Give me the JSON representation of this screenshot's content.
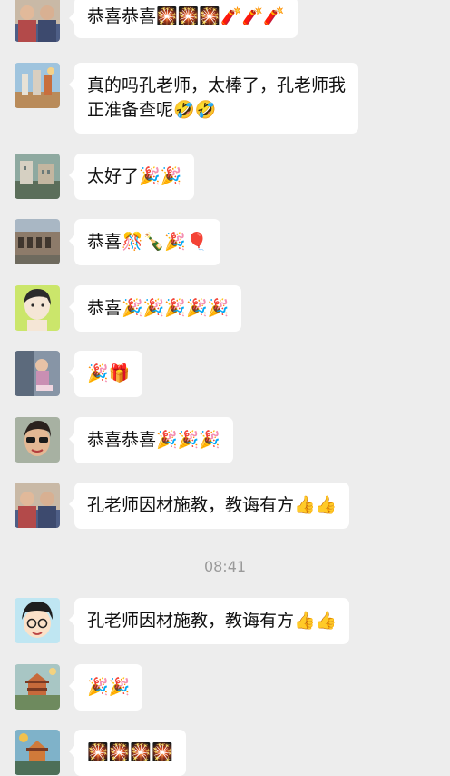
{
  "chat": {
    "timestamp": "08:41",
    "messages": [
      {
        "text": "恭喜恭喜🎇🎇🎇🧨🧨🧨"
      },
      {
        "text_line1": "真的吗孔老师，太棒了，孔老师我",
        "text_line2": "正准备查呢🤣🤣"
      },
      {
        "text": "太好了🎉🎉"
      },
      {
        "text": "恭喜🎊🍾🎉🎈"
      },
      {
        "text": "恭喜🎉🎉🎉🎉🎉"
      },
      {
        "text": "🎉🎁"
      },
      {
        "text": "恭喜恭喜🎉🎉🎉"
      },
      {
        "text": "孔老师因材施教，教诲有方👍👍"
      },
      {
        "text": "孔老师因材施教，教诲有方👍👍"
      },
      {
        "text": "🎉🎉"
      },
      {
        "text": "🎇🎇🎇🎇"
      }
    ]
  }
}
